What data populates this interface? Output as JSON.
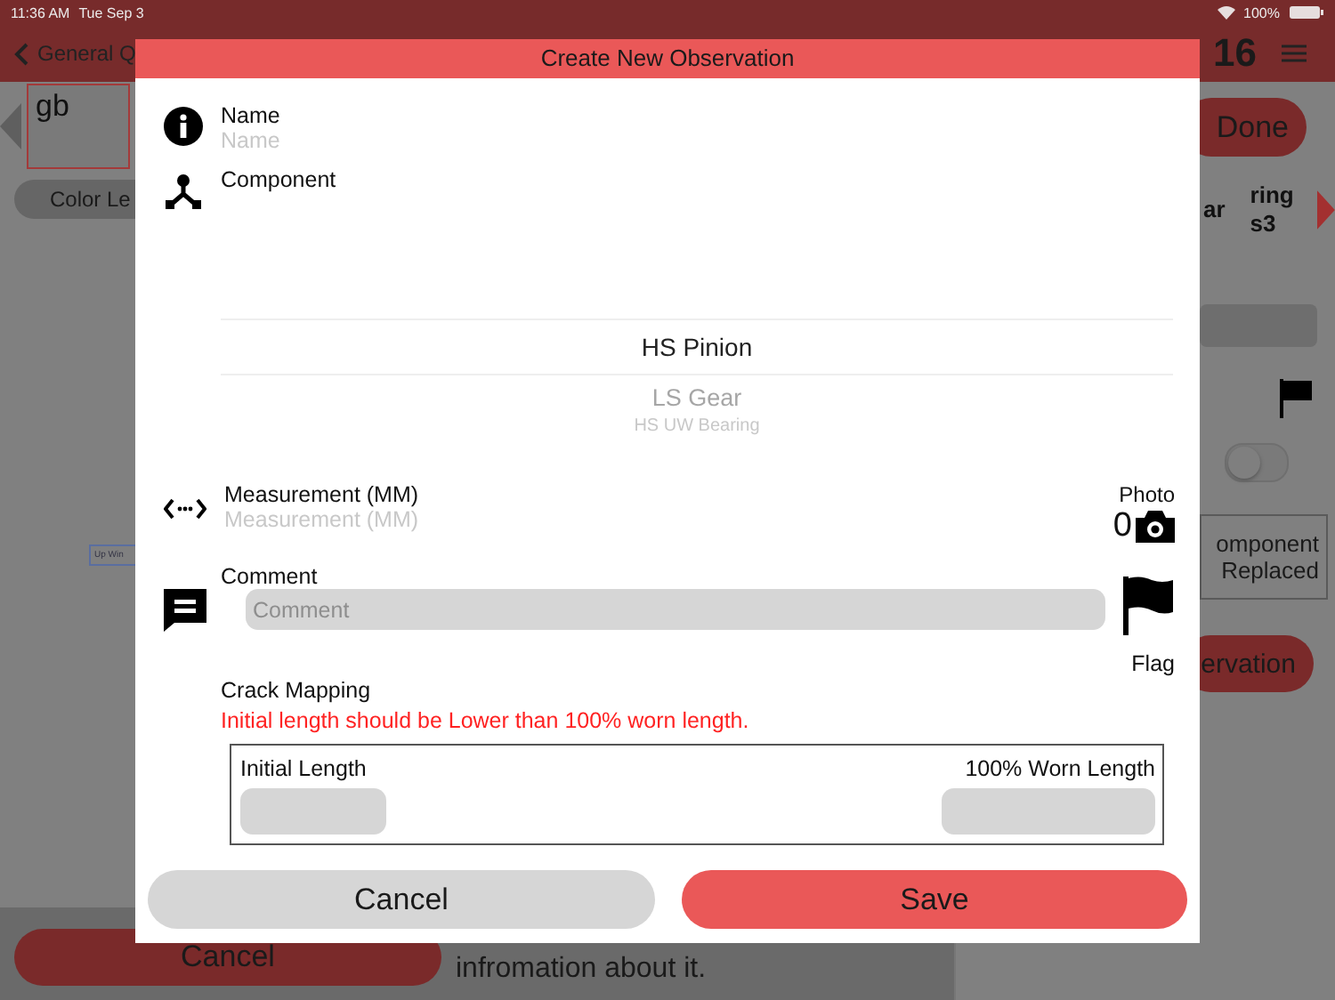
{
  "status_bar": {
    "time": "11:36 AM",
    "date": "Tue Sep 3",
    "battery": "100%"
  },
  "nav": {
    "back": "General Q",
    "number": "16"
  },
  "background": {
    "field_value": "gb",
    "legend": "Color Le",
    "done": "Done",
    "tabs": [
      "ar",
      "ring s3"
    ],
    "mini_label": "Up Win",
    "toggle_on": false,
    "replaced": "omponent Replaced",
    "observation": "ervation",
    "cancel": "Cancel",
    "info": "infromation about it."
  },
  "modal": {
    "title": "Create New Observation",
    "name": {
      "label": "Name",
      "placeholder": "Name"
    },
    "component": {
      "label": "Component",
      "options": [
        {
          "label": "HS Pinion",
          "selected": true
        },
        {
          "label": "LS Gear",
          "selected": false
        },
        {
          "label": "HS UW Bearing",
          "selected": false
        }
      ]
    },
    "measurement": {
      "label": "Measurement (MM)",
      "placeholder": "Measurement (MM)"
    },
    "photo": {
      "label": "Photo",
      "count": "0"
    },
    "comment": {
      "label": "Comment",
      "placeholder": "Comment"
    },
    "flag": {
      "label": "Flag"
    },
    "crack": {
      "title": "Crack Mapping",
      "error": "Initial length should be Lower than 100% worn length.",
      "initial": "Initial Length",
      "worn": "100% Worn Length"
    },
    "buttons": {
      "cancel": "Cancel",
      "save": "Save"
    }
  }
}
